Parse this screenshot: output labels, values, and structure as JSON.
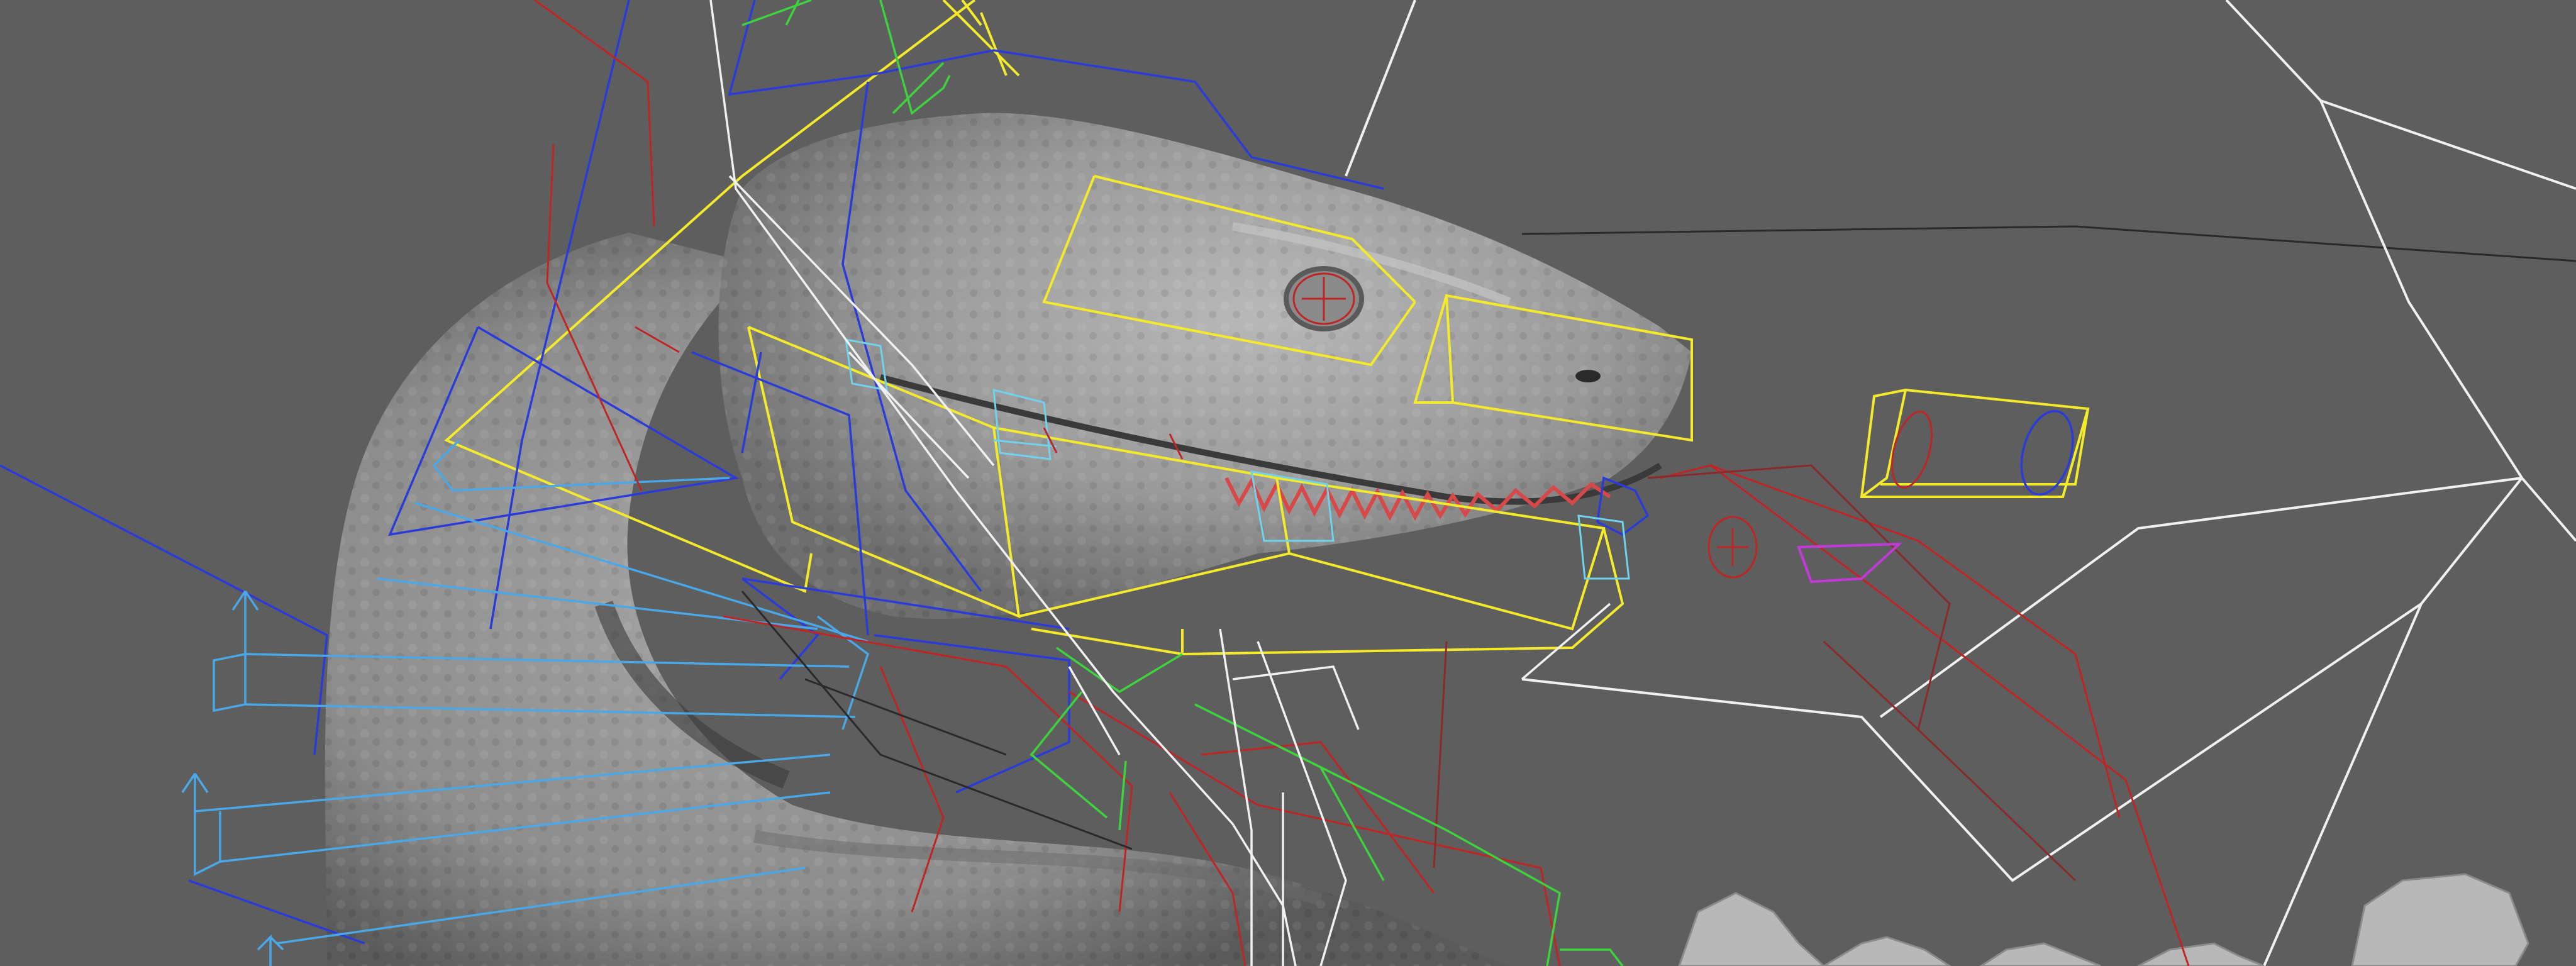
{
  "viewport": {
    "background_color": "#5e5e5e",
    "mesh_color": "#9c9c9c",
    "mesh_highlight_color": "#c8c8c8",
    "mesh_shadow_color": "#4a4a4a",
    "rig_colors": {
      "yellow": "#f2ea2a",
      "blue": "#2b3bd9",
      "light_blue": "#4aa7e8",
      "cyan": "#6fd3ee",
      "red": "#c02525",
      "dark_red": "#8a2a2a",
      "green": "#3fd23f",
      "white": "#f0f0f0",
      "magenta": "#c03ad6",
      "black": "#2a2a2a"
    }
  }
}
